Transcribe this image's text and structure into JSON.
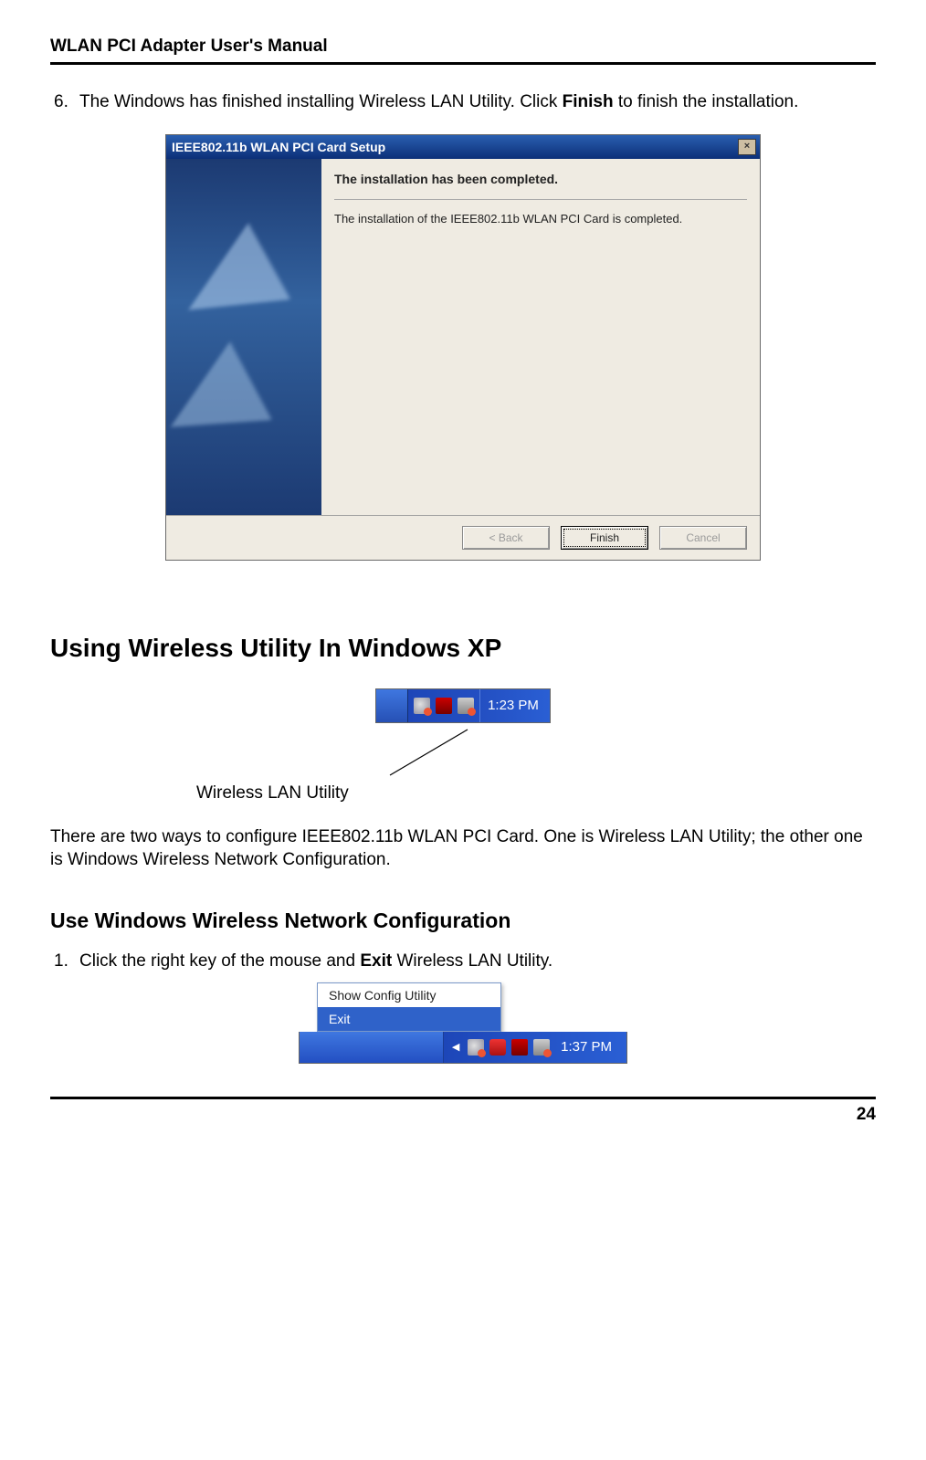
{
  "header": {
    "title": "WLAN PCI Adapter User's Manual"
  },
  "step6": {
    "num": "6.",
    "text_a": "The Windows has finished installing Wireless LAN Utility. Click ",
    "bold": "Finish",
    "text_b": " to finish the installation."
  },
  "installer": {
    "title": "IEEE802.11b WLAN PCI Card Setup",
    "heading": "The installation has been completed.",
    "message": "The installation of the IEEE802.11b WLAN PCI Card is completed.",
    "buttons": {
      "back": "< Back",
      "finish": "Finish",
      "cancel": "Cancel"
    }
  },
  "section1": {
    "title": "Using Wireless Utility In Windows XP"
  },
  "tray1": {
    "clock": "1:23 PM",
    "caption": "Wireless LAN Utility",
    "icons": [
      "network-icon",
      "wlan-utility-icon",
      "pci-card-icon"
    ]
  },
  "paragraph1": "There are two ways to configure IEEE802.11b WLAN PCI Card. One is Wireless LAN Utility; the other one is Windows Wireless Network Configuration.",
  "section2": {
    "title": "Use Windows Wireless Network Configuration"
  },
  "step1": {
    "num": "1.",
    "text_a": "Click the right key of the mouse and ",
    "bold": "Exit",
    "text_b": " Wireless LAN Utility."
  },
  "context_menu": {
    "item1": "Show Config Utility",
    "item2": "Exit"
  },
  "tray2": {
    "clock": "1:37 PM",
    "icons": [
      "chevron-icon",
      "network-icon",
      "shield-icon",
      "wlan-utility-icon",
      "pci-card-icon"
    ]
  },
  "footer": {
    "page": "24"
  }
}
